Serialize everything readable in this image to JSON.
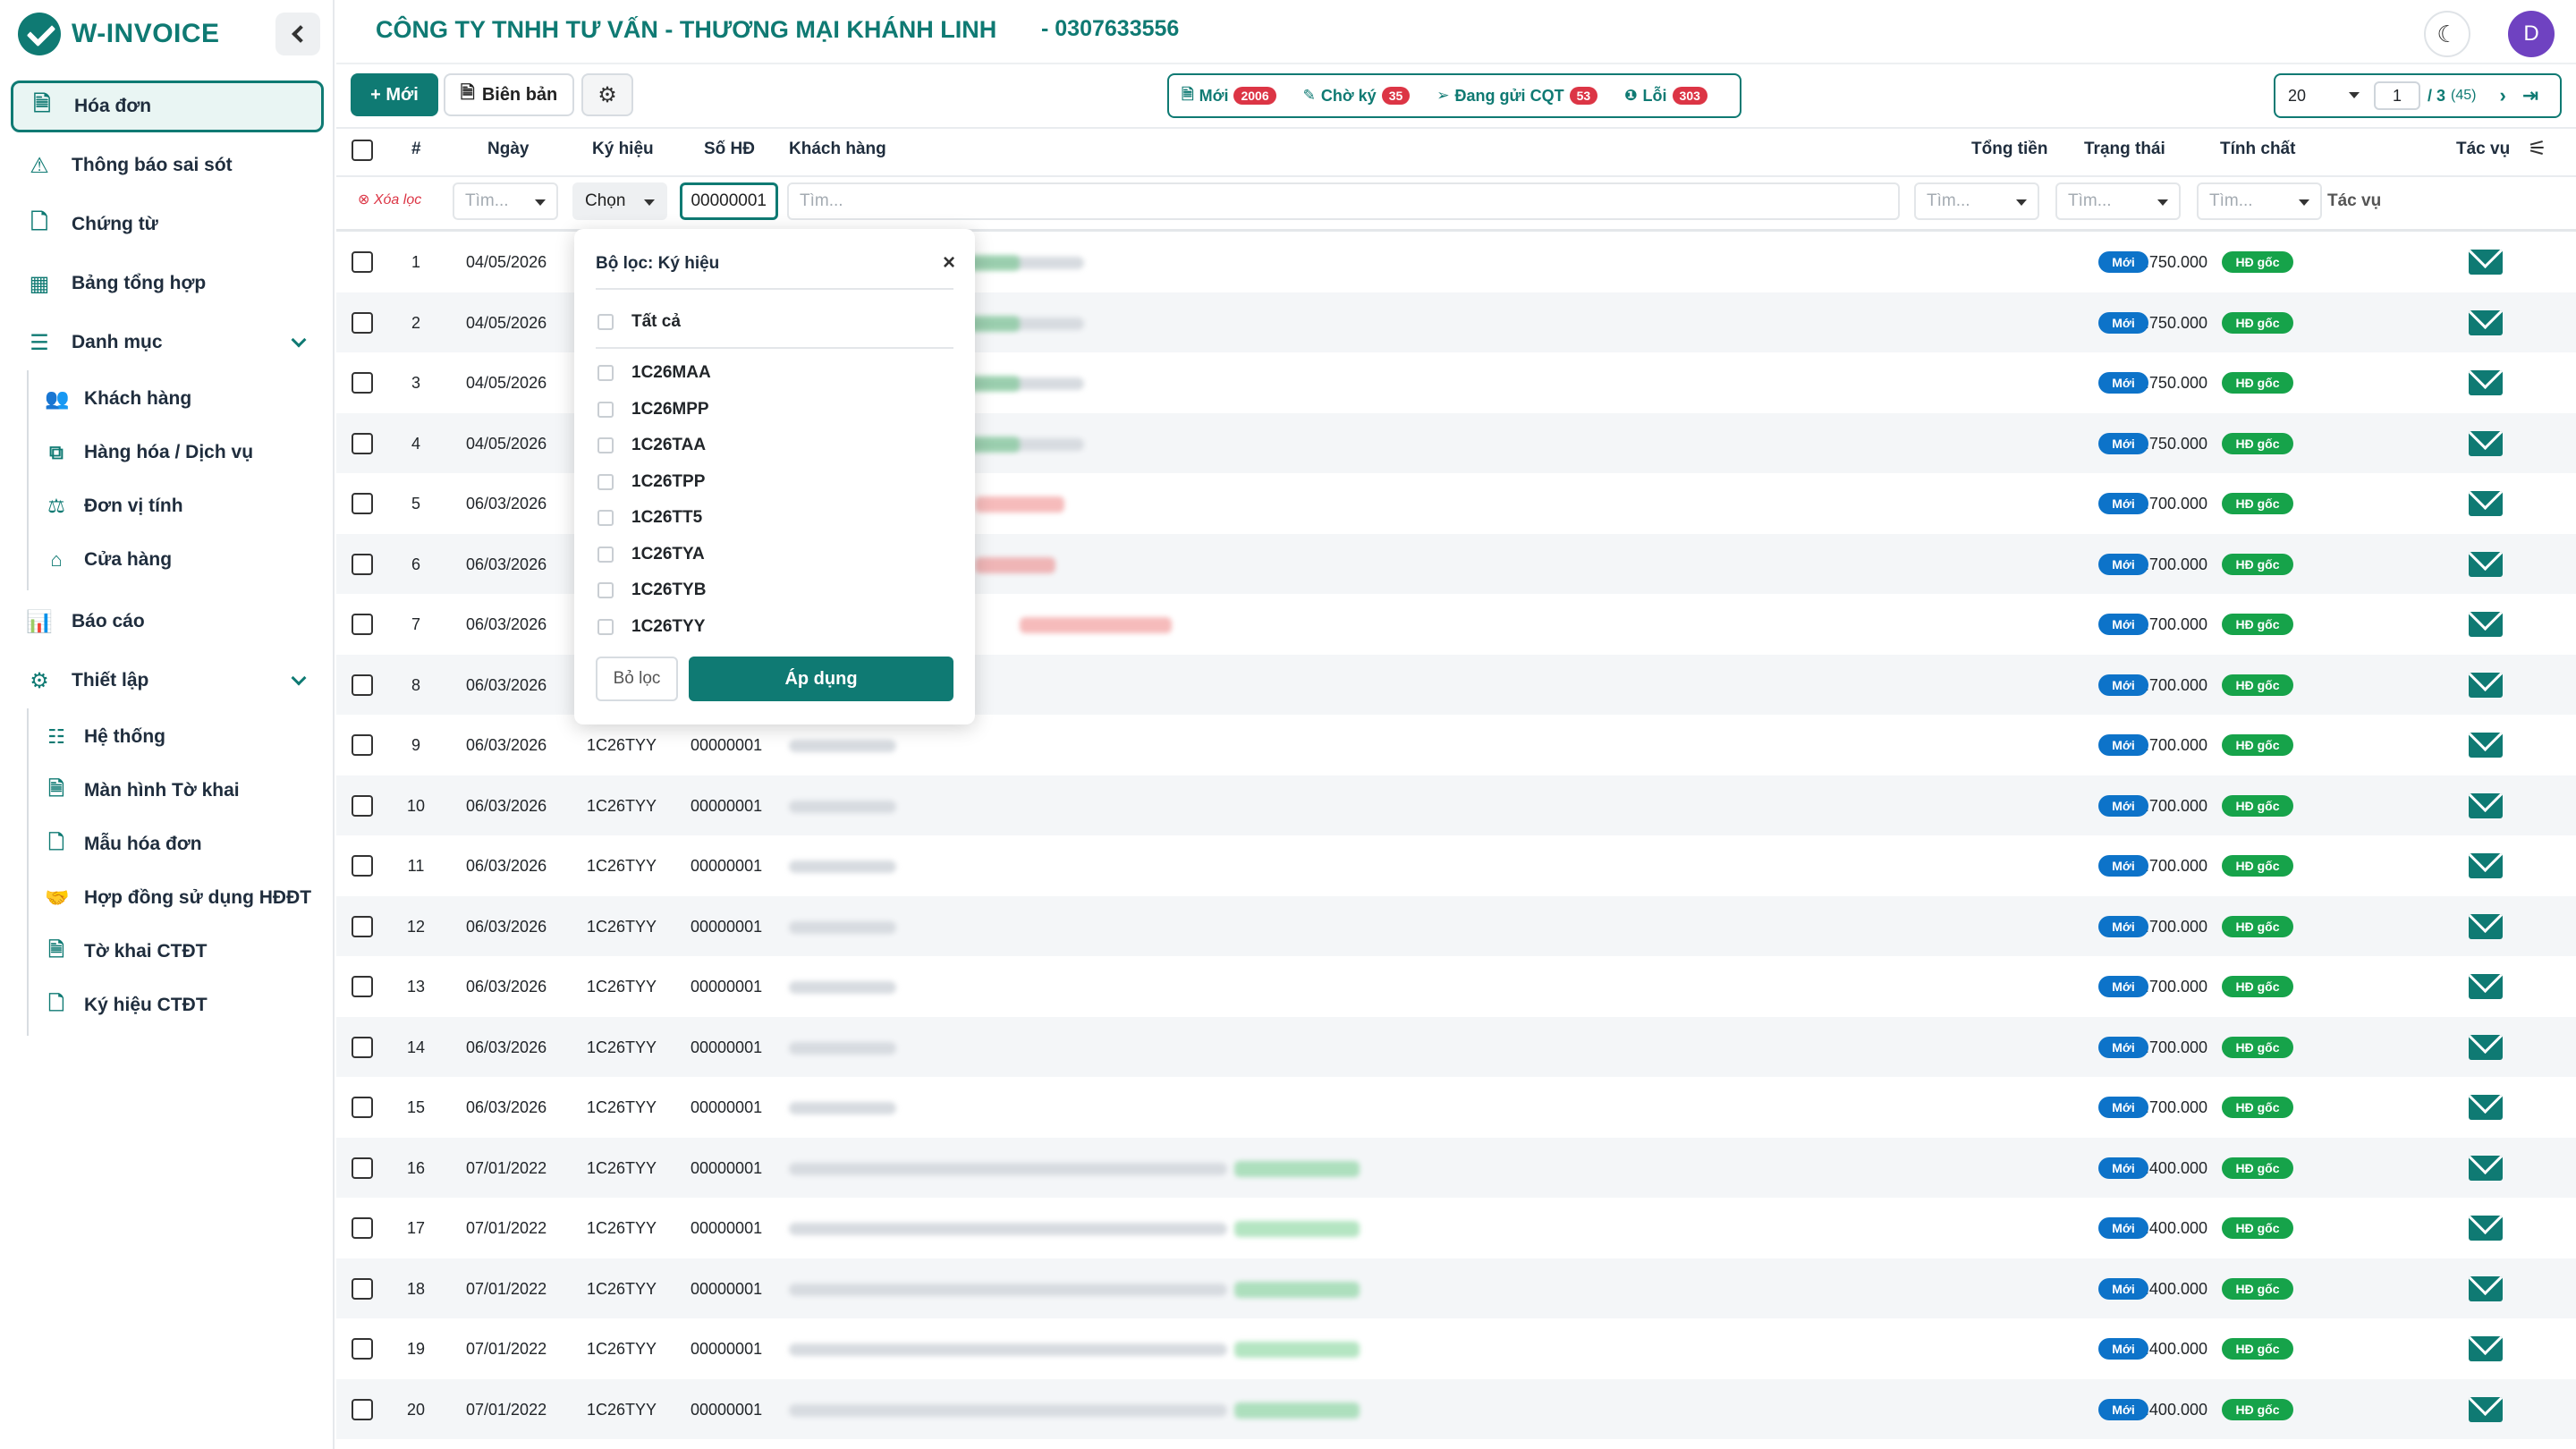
{
  "brand": {
    "name": "W-INVOICE"
  },
  "header": {
    "company": "CÔNG TY TNHH TƯ VẤN - THƯƠNG MẠI KHÁNH LINH",
    "tax_code": "- 0307633556",
    "avatar_letter": "D"
  },
  "sidebar": {
    "items": [
      {
        "label": "Hóa đơn",
        "icon": "document-icon",
        "active": true
      },
      {
        "label": "Thông báo sai sót",
        "icon": "warning-icon"
      },
      {
        "label": "Chứng từ",
        "icon": "file-icon"
      },
      {
        "label": "Bảng tổng hợp",
        "icon": "table-icon"
      },
      {
        "label": "Danh mục",
        "icon": "list-icon"
      },
      {
        "label": "Báo cáo",
        "icon": "chart-icon"
      },
      {
        "label": "Thiết lập",
        "icon": "settings-icon"
      }
    ],
    "danh_muc_sub": [
      "Khách hàng",
      "Hàng hóa / Dịch vụ",
      "Đơn vị tính",
      "Cửa hàng"
    ],
    "thiet_lap_sub": [
      "Hệ thống",
      "Màn hình Tờ khai",
      "Mẫu hóa đơn",
      "Hợp đồng sử dụng HĐĐT",
      "Tờ khai CTĐT",
      "Ký hiệu CTĐT"
    ]
  },
  "toolbar": {
    "new_label": "+ Mới",
    "bien_ban_label": "Biên bản"
  },
  "status_filters": [
    {
      "label": "Mới",
      "count": "2006"
    },
    {
      "label": "Chờ ký",
      "count": "35"
    },
    {
      "label": "Đang gửi CQT",
      "count": "53"
    },
    {
      "label": "Lỗi",
      "count": "303"
    }
  ],
  "pager": {
    "page_size": "20",
    "page": "1",
    "total_pages": "/ 3",
    "total_records": "(45)"
  },
  "table": {
    "headers": {
      "index": "#",
      "date": "Ngày",
      "symbol": "Ký hiệu",
      "number": "Số HĐ",
      "customer": "Khách hàng",
      "total": "Tổng tiền",
      "status": "Trạng thái",
      "nature": "Tính chất",
      "actions": "Tác vụ"
    },
    "filters": {
      "clear": "Xóa lọc",
      "date_placeholder": "Tìm...",
      "symbol_value": "Chọn",
      "number_value": "00000001",
      "customer_placeholder": "Tìm...",
      "total_placeholder": "Tìm...",
      "status_placeholder": "Tìm...",
      "nature_placeholder": "Tìm...",
      "actions_label": "Tác vụ"
    },
    "rows": [
      {
        "i": "1",
        "date": "04/05/2026",
        "symbol": "",
        "number": "",
        "total": "373.750.000",
        "status": "Mới",
        "nature": "HĐ gốc"
      },
      {
        "i": "2",
        "date": "04/05/2026",
        "symbol": "",
        "number": "",
        "total": "373.750.000",
        "status": "Mới",
        "nature": "HĐ gốc"
      },
      {
        "i": "3",
        "date": "04/05/2026",
        "symbol": "",
        "number": "",
        "total": "373.750.000",
        "status": "Mới",
        "nature": "HĐ gốc"
      },
      {
        "i": "4",
        "date": "04/05/2026",
        "symbol": "",
        "number": "",
        "total": "373.750.000",
        "status": "Mới",
        "nature": "HĐ gốc"
      },
      {
        "i": "5",
        "date": "06/03/2026",
        "symbol": "",
        "number": "",
        "total": "13.700.000",
        "status": "Mới",
        "nature": "HĐ gốc"
      },
      {
        "i": "6",
        "date": "06/03/2026",
        "symbol": "",
        "number": "",
        "total": "13.700.000",
        "status": "Mới",
        "nature": "HĐ gốc"
      },
      {
        "i": "7",
        "date": "06/03/2026",
        "symbol": "",
        "number": "",
        "total": "13.700.000",
        "status": "Mới",
        "nature": "HĐ gốc"
      },
      {
        "i": "8",
        "date": "06/03/2026",
        "symbol": "",
        "number": "",
        "total": "13.700.000",
        "status": "Mới",
        "nature": "HĐ gốc"
      },
      {
        "i": "9",
        "date": "06/03/2026",
        "symbol": "1C26TYY",
        "number": "00000001",
        "total": "13.700.000",
        "status": "Mới",
        "nature": "HĐ gốc"
      },
      {
        "i": "10",
        "date": "06/03/2026",
        "symbol": "1C26TYY",
        "number": "00000001",
        "total": "13.700.000",
        "status": "Mới",
        "nature": "HĐ gốc"
      },
      {
        "i": "11",
        "date": "06/03/2026",
        "symbol": "1C26TYY",
        "number": "00000001",
        "total": "13.700.000",
        "status": "Mới",
        "nature": "HĐ gốc"
      },
      {
        "i": "12",
        "date": "06/03/2026",
        "symbol": "1C26TYY",
        "number": "00000001",
        "total": "13.700.000",
        "status": "Mới",
        "nature": "HĐ gốc"
      },
      {
        "i": "13",
        "date": "06/03/2026",
        "symbol": "1C26TYY",
        "number": "00000001",
        "total": "13.700.000",
        "status": "Mới",
        "nature": "HĐ gốc"
      },
      {
        "i": "14",
        "date": "06/03/2026",
        "symbol": "1C26TYY",
        "number": "00000001",
        "total": "13.700.000",
        "status": "Mới",
        "nature": "HĐ gốc"
      },
      {
        "i": "15",
        "date": "06/03/2026",
        "symbol": "1C26TYY",
        "number": "00000001",
        "total": "13.700.000",
        "status": "Mới",
        "nature": "HĐ gốc"
      },
      {
        "i": "16",
        "date": "07/01/2022",
        "symbol": "1C26TYY",
        "number": "00000001",
        "total": "491.400.000",
        "status": "Mới",
        "nature": "HĐ gốc"
      },
      {
        "i": "17",
        "date": "07/01/2022",
        "symbol": "1C26TYY",
        "number": "00000001",
        "total": "491.400.000",
        "status": "Mới",
        "nature": "HĐ gốc"
      },
      {
        "i": "18",
        "date": "07/01/2022",
        "symbol": "1C26TYY",
        "number": "00000001",
        "total": "491.400.000",
        "status": "Mới",
        "nature": "HĐ gốc"
      },
      {
        "i": "19",
        "date": "07/01/2022",
        "symbol": "1C26TYY",
        "number": "00000001",
        "total": "491.400.000",
        "status": "Mới",
        "nature": "HĐ gốc"
      },
      {
        "i": "20",
        "date": "07/01/2022",
        "symbol": "1C26TYY",
        "number": "00000001",
        "total": "491.400.000",
        "status": "Mới",
        "nature": "HĐ gốc"
      }
    ]
  },
  "symbol_filter_popup": {
    "title": "Bộ lọc: Ký hiệu",
    "all_label": "Tất cả",
    "options": [
      "1C26MAA",
      "1C26MPP",
      "1C26TAA",
      "1C26TPP",
      "1C26TT5",
      "1C26TYA",
      "1C26TYB",
      "1C26TYY"
    ],
    "reset_label": "Bỏ lọc",
    "apply_label": "Áp dụng"
  },
  "colors": {
    "primary": "#0f7a73",
    "badge_new": "#0d73c9",
    "badge_original": "#16a34a",
    "count_badge": "#dc3545"
  }
}
